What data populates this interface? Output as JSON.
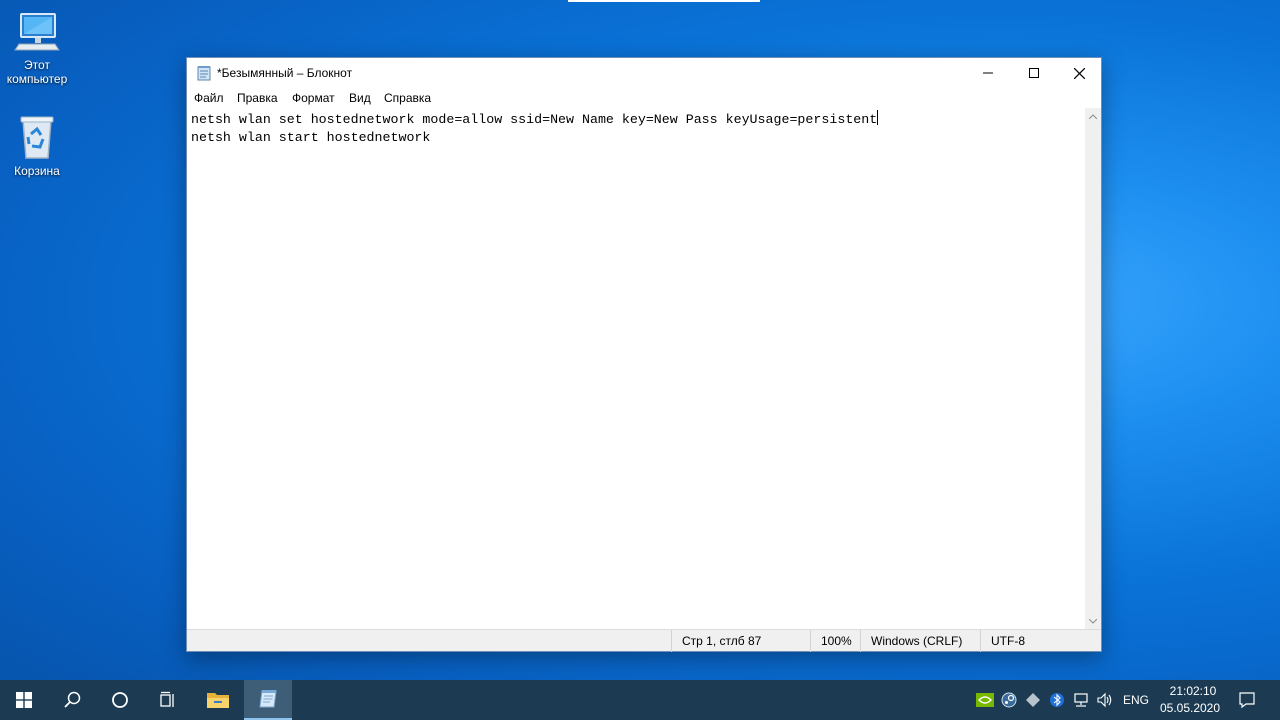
{
  "desktop": {
    "icons": [
      {
        "label": "Этот компьютер"
      },
      {
        "label": "Корзина"
      }
    ]
  },
  "window": {
    "title": "*Безымянный – Блокнот",
    "menu": [
      "Файл",
      "Правка",
      "Формат",
      "Вид",
      "Справка"
    ],
    "lines": [
      "netsh wlan set hostednetwork mode=allow ssid=New Name key=New Pass keyUsage=persistent",
      "netsh wlan start hostednetwork"
    ],
    "status": {
      "position": "Стр 1, стлб 87",
      "zoom": "100%",
      "line_ending": "Windows (CRLF)",
      "encoding": "UTF-8"
    }
  },
  "taskbar": {
    "language": "ENG",
    "time": "21:02:10",
    "date": "05.05.2020",
    "pinned": [
      "windows-start-icon",
      "search-icon",
      "cortana-icon",
      "task-view-icon",
      "file-explorer-icon",
      "notepad-icon"
    ]
  },
  "colors": {
    "desktop_accent": "#0a73d8",
    "taskbar": "#1c3b52",
    "window_border": "#6f8fb5"
  }
}
